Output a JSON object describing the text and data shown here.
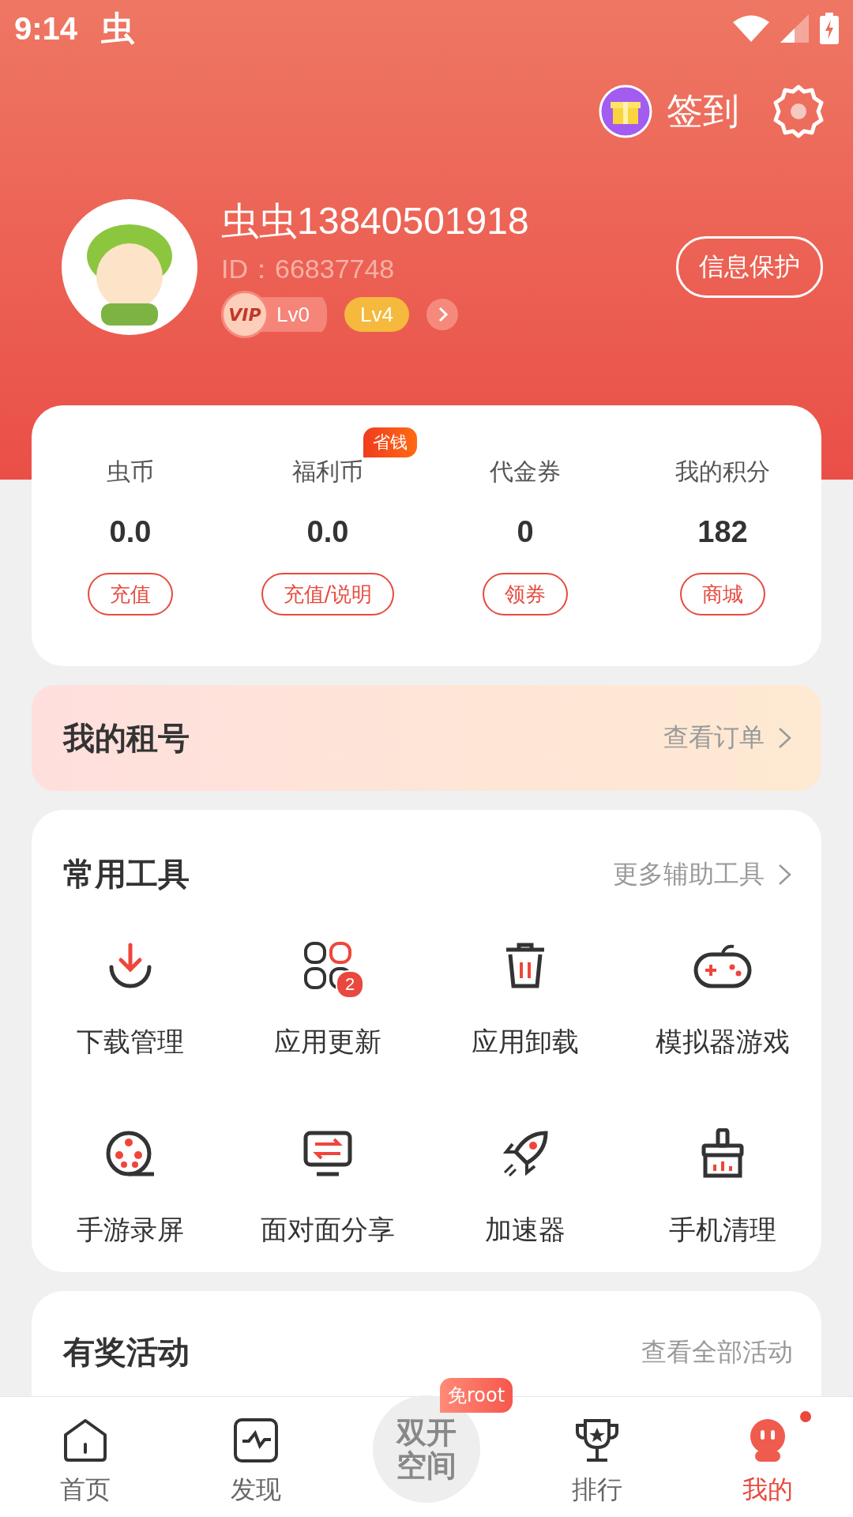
{
  "status_bar": {
    "time": "9:14",
    "app_glyph": "虫"
  },
  "header": {
    "checkin_label": "签到"
  },
  "profile": {
    "name": "虫虫13840501918",
    "id": "ID：66837748",
    "vip_badge": "VIP",
    "vip_level": "Lv0",
    "level": "Lv4",
    "protect_button": "信息保护"
  },
  "stats": [
    {
      "label": "虫币",
      "value": "0.0",
      "button": "充值"
    },
    {
      "label": "福利币",
      "value": "0.0",
      "button": "充值/说明",
      "tag": "省钱"
    },
    {
      "label": "代金券",
      "value": "0",
      "button": "领券"
    },
    {
      "label": "我的积分",
      "value": "182",
      "button": "商城"
    }
  ],
  "rental": {
    "title": "我的租号",
    "link": "查看订单"
  },
  "tools": {
    "title": "常用工具",
    "link": "更多辅助工具",
    "items": [
      {
        "kind": "download",
        "label": "下载管理"
      },
      {
        "kind": "update",
        "label": "应用更新",
        "badge": "2"
      },
      {
        "kind": "uninstall",
        "label": "应用卸载"
      },
      {
        "kind": "gamepad",
        "label": "模拟器游戏"
      },
      {
        "kind": "record",
        "label": "手游录屏"
      },
      {
        "kind": "share",
        "label": "面对面分享"
      },
      {
        "kind": "rocket",
        "label": "加速器"
      },
      {
        "kind": "clean",
        "label": "手机清理"
      }
    ]
  },
  "activity": {
    "title": "有奖活动",
    "link": "查看全部活动"
  },
  "bottom_nav": [
    {
      "kind": "home",
      "label": "首页",
      "selected": false
    },
    {
      "kind": "discover",
      "label": "发现",
      "selected": false
    },
    {
      "kind": "center",
      "label": "双开空间",
      "tag": "免root",
      "selected": false
    },
    {
      "kind": "rank",
      "label": "排行",
      "selected": false
    },
    {
      "kind": "mine",
      "label": "我的",
      "selected": true,
      "dot": true
    }
  ]
}
